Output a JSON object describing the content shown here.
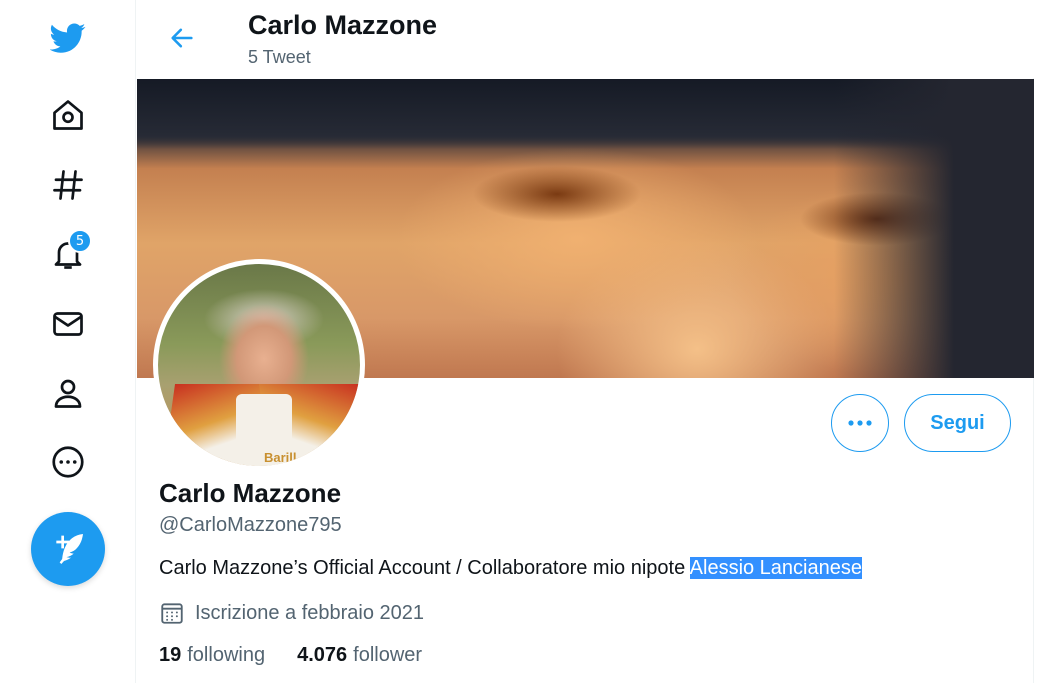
{
  "nav": {
    "notifications_badge": "5"
  },
  "header": {
    "title": "Carlo Mazzone",
    "tweet_count": "5 Tweet"
  },
  "profile": {
    "display_name": "Carlo Mazzone",
    "handle": "@CarloMazzone795",
    "bio_text": "Carlo Mazzone’s Official Account / Collaboratore mio nipote ",
    "bio_highlight": "Alessio Lancianese",
    "joined": "Iscrizione a febbraio 2021",
    "avatar_jacket_text": "Barill",
    "following_count": "19",
    "following_label": "following",
    "follower_count": "4.076",
    "follower_label": "follower"
  },
  "actions": {
    "follow_label": "Segui"
  },
  "colors": {
    "accent": "#1d9bf0",
    "text": "#0f1419",
    "muted": "#536471",
    "selection": "#3390ff"
  }
}
